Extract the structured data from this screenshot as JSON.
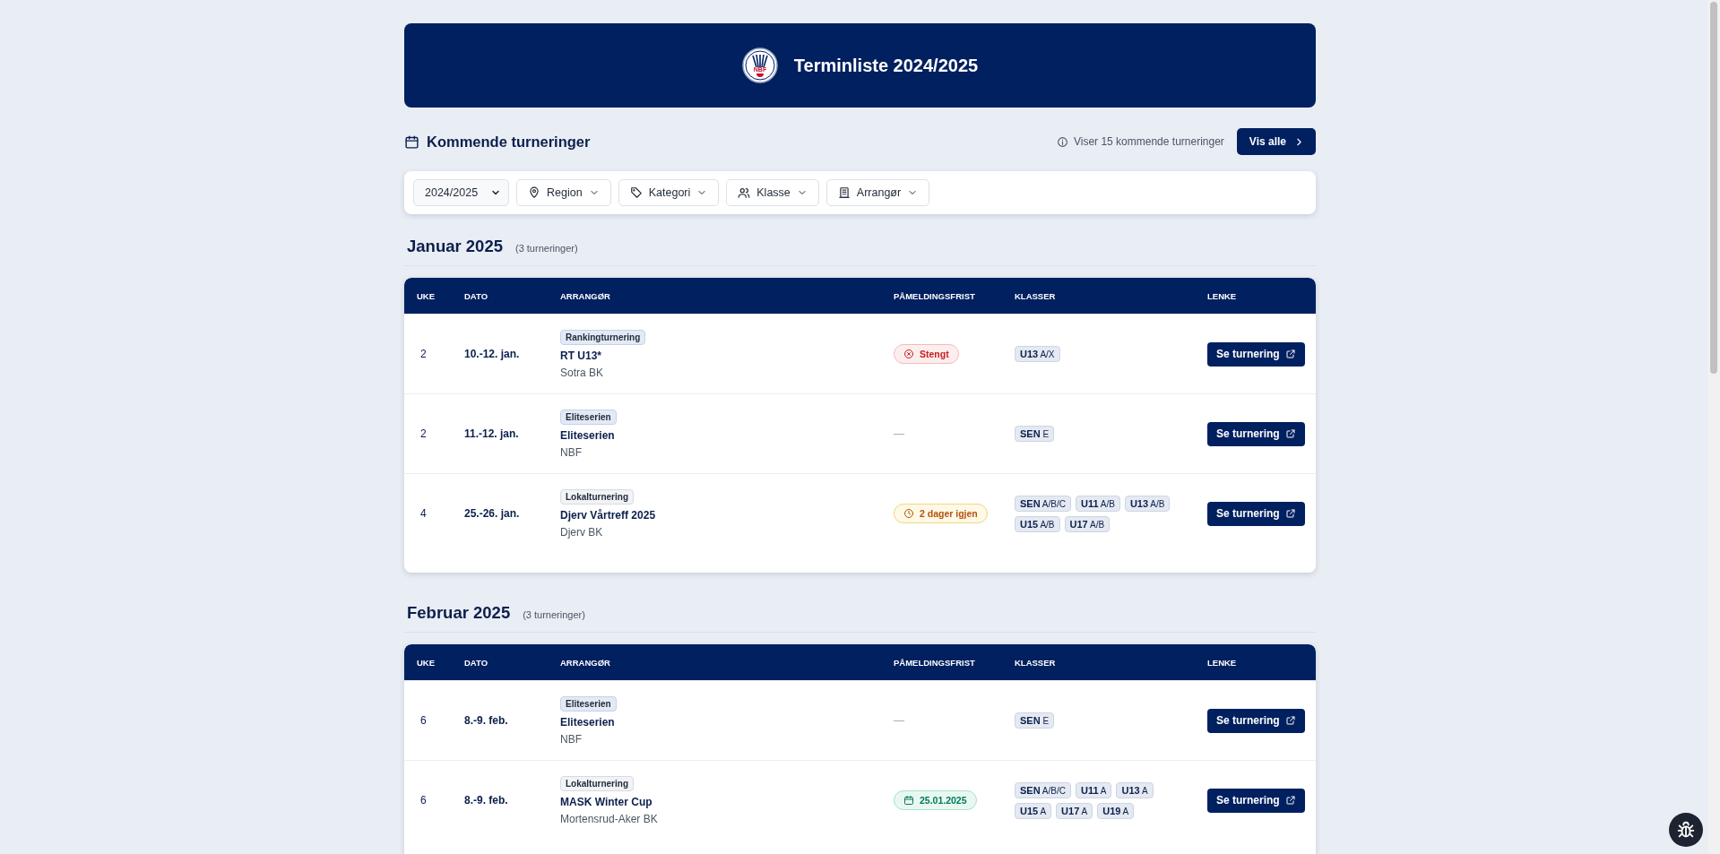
{
  "header": {
    "logo_text": "NBF",
    "title": "Terminliste 2024/2025"
  },
  "section": {
    "title": "Kommende turneringer",
    "info": "Viser 15 kommende turneringer",
    "button": "Vis alle"
  },
  "filters": [
    {
      "kind": "select",
      "label": "2024/2025"
    },
    {
      "kind": "region",
      "label": "Region"
    },
    {
      "kind": "category",
      "label": "Kategori"
    },
    {
      "kind": "class",
      "label": "Klasse"
    },
    {
      "kind": "organizer",
      "label": "Arrangør"
    }
  ],
  "months": [
    {
      "title": "Januar 2025",
      "count": "(3 turneringer)",
      "columns": [
        "UKE",
        "DATO",
        "ARRANGØR",
        "PÅMELDINGSFRIST",
        "KLASSER",
        "LENKE"
      ],
      "rows": [
        {
          "week": "2",
          "date": "10.-12. jan.",
          "category": {
            "label": "Rankingturnering",
            "kind": "ranking"
          },
          "name": "RT U13*",
          "organizer": "Sotra BK",
          "deadline": {
            "kind": "closed",
            "text": "Stengt"
          },
          "classes": [
            {
              "name": "U13",
              "levels": "A/X"
            }
          ],
          "link": "Se turnering"
        },
        {
          "week": "2",
          "date": "11.-12. jan.",
          "category": {
            "label": "Eliteserien",
            "kind": "elite"
          },
          "name": "Eliteserien",
          "organizer": "NBF",
          "deadline": {
            "kind": "none",
            "text": "—"
          },
          "classes": [
            {
              "name": "SEN",
              "levels": "E"
            }
          ],
          "link": "Se turnering"
        },
        {
          "week": "4",
          "date": "25.-26. jan.",
          "category": {
            "label": "Lokalturnering",
            "kind": "local"
          },
          "name": "Djerv Vårtreff 2025",
          "organizer": "Djerv BK",
          "deadline": {
            "kind": "countdown",
            "text": "2 dager igjen"
          },
          "classes": [
            {
              "name": "SEN",
              "levels": "A/B/C"
            },
            {
              "name": "U11",
              "levels": "A/B"
            },
            {
              "name": "U13",
              "levels": "A/B"
            },
            {
              "name": "U15",
              "levels": "A/B"
            },
            {
              "name": "U17",
              "levels": "A/B"
            }
          ],
          "link": "Se turnering"
        }
      ]
    },
    {
      "title": "Februar 2025",
      "count": "(3 turneringer)",
      "columns": [
        "UKE",
        "DATO",
        "ARRANGØR",
        "PÅMELDINGSFRIST",
        "KLASSER",
        "LENKE"
      ],
      "rows": [
        {
          "week": "6",
          "date": "8.-9. feb.",
          "category": {
            "label": "Eliteserien",
            "kind": "elite"
          },
          "name": "Eliteserien",
          "organizer": "NBF",
          "deadline": {
            "kind": "none",
            "text": "—"
          },
          "classes": [
            {
              "name": "SEN",
              "levels": "E"
            }
          ],
          "link": "Se turnering"
        },
        {
          "week": "6",
          "date": "8.-9. feb.",
          "category": {
            "label": "Lokalturnering",
            "kind": "local"
          },
          "name": "MASK Winter Cup",
          "organizer": "Mortensrud-Aker BK",
          "deadline": {
            "kind": "date",
            "text": "25.01.2025"
          },
          "classes": [
            {
              "name": "SEN",
              "levels": "A/B/C"
            },
            {
              "name": "U11",
              "levels": "A"
            },
            {
              "name": "U13",
              "levels": "A"
            },
            {
              "name": "U15",
              "levels": "A"
            },
            {
              "name": "U17",
              "levels": "A"
            },
            {
              "name": "U19",
              "levels": "A"
            }
          ],
          "link": "Se turnering"
        }
      ]
    }
  ]
}
